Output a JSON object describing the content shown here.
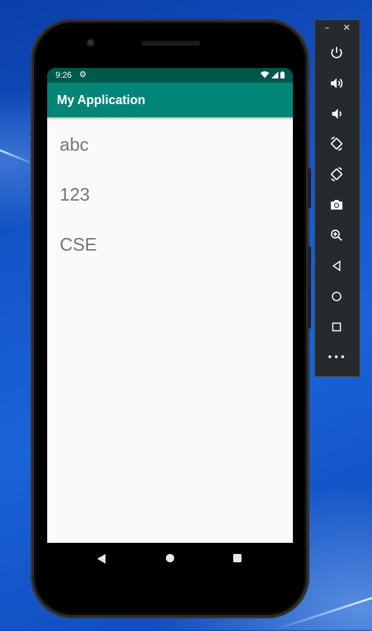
{
  "status_bar": {
    "time": "9:26"
  },
  "app_bar": {
    "title": "My Application"
  },
  "content": {
    "lines": [
      "abc",
      "123",
      "CSE"
    ]
  },
  "emulator_toolbar": {
    "window_controls": {
      "minimize": "–",
      "close": "✕"
    },
    "buttons": [
      {
        "name": "power",
        "icon": "power-icon"
      },
      {
        "name": "volume-up",
        "icon": "volume-up-icon"
      },
      {
        "name": "volume-down",
        "icon": "volume-down-icon"
      },
      {
        "name": "rotate-left",
        "icon": "rotate-left-icon"
      },
      {
        "name": "rotate-right",
        "icon": "rotate-right-icon"
      },
      {
        "name": "screenshot",
        "icon": "camera-icon"
      },
      {
        "name": "zoom",
        "icon": "zoom-icon"
      },
      {
        "name": "back",
        "icon": "back-icon"
      },
      {
        "name": "home",
        "icon": "home-icon"
      },
      {
        "name": "overview",
        "icon": "overview-icon"
      },
      {
        "name": "more",
        "icon": "more-icon"
      }
    ],
    "more_label": "•••"
  },
  "colors": {
    "status_bar": "#00574b",
    "app_bar": "#008577",
    "screen_bg": "#fafafa",
    "content_text": "#757575",
    "toolbar_bg": "#262a2f"
  }
}
